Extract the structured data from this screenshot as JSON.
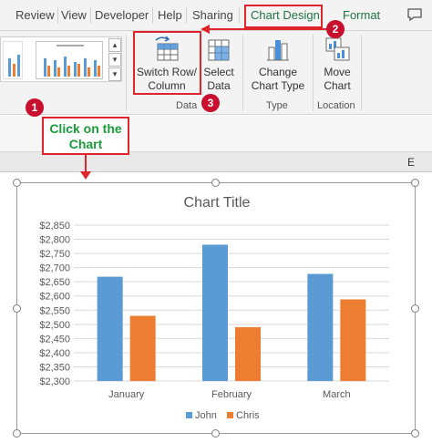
{
  "tabs": [
    {
      "label": "Review"
    },
    {
      "label": "View"
    },
    {
      "label": "Developer"
    },
    {
      "label": "Help"
    },
    {
      "label": "Sharing"
    },
    {
      "label": "Chart Design"
    },
    {
      "label": "Format"
    }
  ],
  "ribbon": {
    "switch_row_column": {
      "line1": "Switch Row/",
      "line2": "Column"
    },
    "select_data": {
      "line1": "Select",
      "line2": "Data"
    },
    "change_chart_type": {
      "line1": "Change",
      "line2": "Chart Type"
    },
    "move_chart": {
      "line1": "Move",
      "line2": "Chart"
    },
    "groups": {
      "data": "Data",
      "type": "Type",
      "location": "Location"
    }
  },
  "sheet": {
    "column_letter": "E"
  },
  "annotations": {
    "badge1": "1",
    "badge2": "2",
    "badge3": "3",
    "callout_line1": "Click on the",
    "callout_line2": "Chart"
  },
  "colors": {
    "accent_green": "#217346",
    "annotation_red": "#e0242c",
    "series_john": "#5b9bd5",
    "series_chris": "#ed7d31"
  },
  "icons": [
    "comment-icon",
    "switch-row-column-icon",
    "select-data-icon",
    "change-chart-type-icon",
    "move-chart-icon"
  ],
  "chart_data": {
    "type": "bar",
    "title": "Chart Title",
    "categories": [
      "January",
      "February",
      "March"
    ],
    "series": [
      {
        "name": "John",
        "values": [
          2668,
          2781,
          2678
        ],
        "color": "#5b9bd5"
      },
      {
        "name": "Chris",
        "values": [
          2530,
          2490,
          2588
        ],
        "color": "#ed7d31"
      }
    ],
    "ylim": [
      2300,
      2850
    ],
    "ytick_step": 50,
    "ytick_labels": [
      "$2,300",
      "$2,350",
      "$2,400",
      "$2,450",
      "$2,500",
      "$2,550",
      "$2,600",
      "$2,650",
      "$2,700",
      "$2,750",
      "$2,800",
      "$2,850"
    ],
    "grid": true,
    "legend": "bottom"
  }
}
